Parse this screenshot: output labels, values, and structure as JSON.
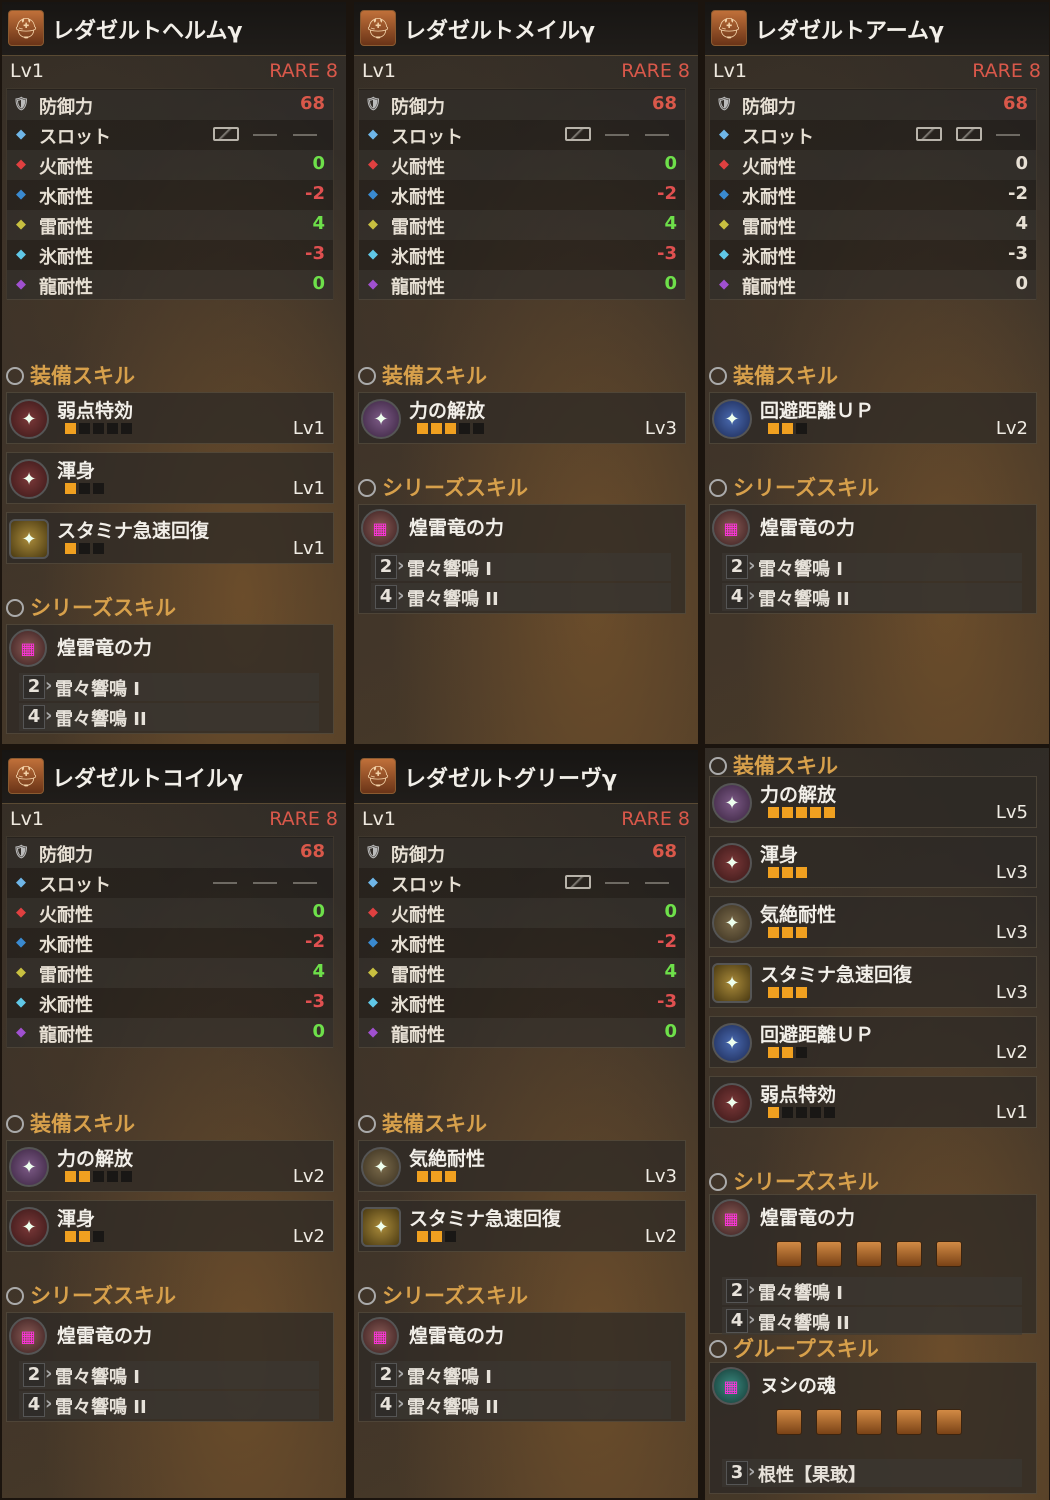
{
  "common": {
    "level": "Lv1",
    "rarity": "RARE 8",
    "stat_labels": [
      "防御力",
      "スロット",
      "火耐性",
      "水耐性",
      "雷耐性",
      "氷耐性",
      "龍耐性"
    ],
    "equip_skill_header": "装備スキル",
    "series_skill_header": "シリーズスキル",
    "group_skill_header": "グループスキル",
    "series_name": "煌雷竜の力",
    "series_bonus": [
      {
        "pieces": "2",
        "name": "雷々響鳴 I"
      },
      {
        "pieces": "4",
        "name": "雷々響鳴 II"
      }
    ]
  },
  "panels": [
    {
      "name": "レダゼルトヘルムγ",
      "defense": "68",
      "fire": "0",
      "water": "-2",
      "thunder": "4",
      "ice": "-3",
      "dragon": "0",
      "slots": [
        "gem",
        "empty",
        "empty"
      ],
      "skills": [
        {
          "name": "弱点特効",
          "level": "Lv1",
          "pips": 1,
          "max": 5,
          "icon": "red"
        },
        {
          "name": "渾身",
          "level": "Lv1",
          "pips": 1,
          "max": 3,
          "icon": "red"
        },
        {
          "name": "スタミナ急速回復",
          "level": "Lv1",
          "pips": 1,
          "max": 3,
          "icon": "gold"
        }
      ]
    },
    {
      "name": "レダゼルトメイルγ",
      "defense": "68",
      "fire": "0",
      "water": "-2",
      "thunder": "4",
      "ice": "-3",
      "dragon": "0",
      "slots": [
        "gem",
        "empty",
        "empty"
      ],
      "skills": [
        {
          "name": "力の解放",
          "level": "Lv3",
          "pips": 3,
          "max": 5,
          "icon": "purple"
        }
      ]
    },
    {
      "name": "レダゼルトアームγ",
      "defense": "68",
      "fire": "0",
      "water": "-2",
      "thunder": "4",
      "ice": "-3",
      "dragon": "0",
      "slots": [
        "gem",
        "gem",
        "empty"
      ],
      "skills": [
        {
          "name": "回避距離ＵＰ",
          "level": "Lv2",
          "pips": 2,
          "max": 3,
          "icon": "blue"
        }
      ]
    },
    {
      "name": "レダゼルトコイルγ",
      "defense": "68",
      "fire": "0",
      "water": "-2",
      "thunder": "4",
      "ice": "-3",
      "dragon": "0",
      "slots": [
        "empty",
        "empty",
        "empty"
      ],
      "skills": [
        {
          "name": "力の解放",
          "level": "Lv2",
          "pips": 2,
          "max": 5,
          "icon": "purple"
        },
        {
          "name": "渾身",
          "level": "Lv2",
          "pips": 2,
          "max": 3,
          "icon": "red"
        }
      ]
    },
    {
      "name": "レダゼルトグリーヴγ",
      "defense": "68",
      "fire": "0",
      "water": "-2",
      "thunder": "4",
      "ice": "-3",
      "dragon": "0",
      "slots": [
        "gem",
        "empty",
        "empty"
      ],
      "skills": [
        {
          "name": "気絶耐性",
          "level": "Lv3",
          "pips": 3,
          "max": 3,
          "icon": "shield"
        },
        {
          "name": "スタミナ急速回復",
          "level": "Lv2",
          "pips": 2,
          "max": 3,
          "icon": "gold"
        }
      ]
    }
  ],
  "summary": {
    "skills": [
      {
        "name": "力の解放",
        "level": "Lv5",
        "pips": 5,
        "max": 5,
        "icon": "purple"
      },
      {
        "name": "渾身",
        "level": "Lv3",
        "pips": 3,
        "max": 3,
        "icon": "red"
      },
      {
        "name": "気絶耐性",
        "level": "Lv3",
        "pips": 3,
        "max": 3,
        "icon": "shield"
      },
      {
        "name": "スタミナ急速回復",
        "level": "Lv3",
        "pips": 3,
        "max": 3,
        "icon": "gold"
      },
      {
        "name": "回避距離ＵＰ",
        "level": "Lv2",
        "pips": 2,
        "max": 3,
        "icon": "blue"
      },
      {
        "name": "弱点特効",
        "level": "Lv1",
        "pips": 1,
        "max": 5,
        "icon": "red"
      }
    ],
    "group_name": "ヌシの魂",
    "group_bonus": {
      "pieces": "3",
      "name": "根性【果敢】"
    }
  }
}
